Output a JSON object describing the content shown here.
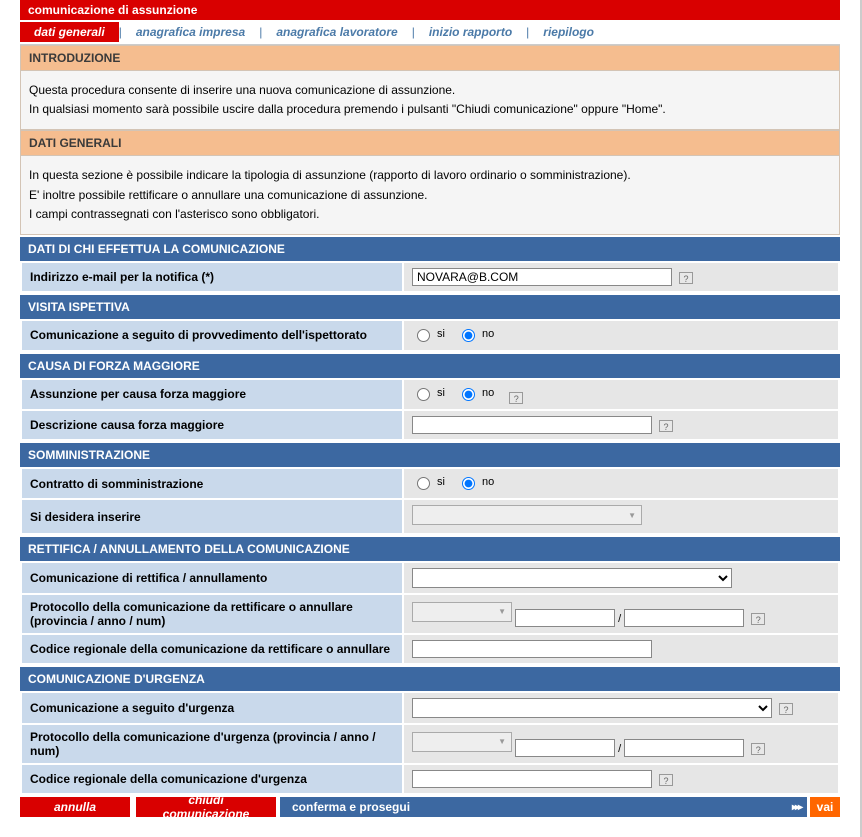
{
  "title_bar": "comunicazione di assunzione",
  "tabs": {
    "t0": "dati generali",
    "t1": "anagrafica impresa",
    "t2": "anagrafica lavoratore",
    "t3": "inizio rapporto",
    "t4": "riepilogo"
  },
  "intro": {
    "header": "INTRODUZIONE",
    "body1": "Questa procedura consente di inserire una nuova comunicazione di assunzione.",
    "body2": "In qualsiasi momento sarà possibile uscire dalla procedura premendo i pulsanti \"Chiudi comunicazione\" oppure \"Home\"."
  },
  "dati_generali": {
    "header": "DATI GENERALI",
    "body1": "In questa sezione è possibile indicare la tipologia di assunzione (rapporto di lavoro ordinario o somministrazione).",
    "body2": "E' inoltre possibile rettificare o annullare una comunicazione di assunzione.",
    "body3": "I campi contrassegnati con l'asterisco sono obbligatori."
  },
  "sections": {
    "s1": {
      "header": "DATI DI CHI EFFETTUA LA COMUNICAZIONE",
      "email_label": "Indirizzo e-mail per la notifica (*)",
      "email_value": "NOVARA@B.COM"
    },
    "s2": {
      "header": "VISITA ISPETTIVA",
      "label": "Comunicazione a seguito di provvedimento dell'ispettorato"
    },
    "s3": {
      "header": "CAUSA DI FORZA MAGGIORE",
      "label1": "Assunzione per causa forza maggiore",
      "label2": "Descrizione causa forza maggiore"
    },
    "s4": {
      "header": "SOMMINISTRAZIONE",
      "label1": "Contratto di somministrazione",
      "label2": "Si desidera inserire"
    },
    "s5": {
      "header": "RETTIFICA / ANNULLAMENTO DELLA COMUNICAZIONE",
      "label1": "Comunicazione di rettifica / annullamento",
      "label2": "Protocollo della comunicazione da rettificare o annullare (provincia / anno / num)",
      "label3": "Codice regionale della comunicazione da rettificare o annullare"
    },
    "s6": {
      "header": "COMUNICAZIONE D'URGENZA",
      "label1": "Comunicazione a seguito d'urgenza",
      "label2": "Protocollo della comunicazione d'urgenza (provincia / anno / num)",
      "label3": "Codice regionale della comunicazione d'urgenza"
    }
  },
  "radio": {
    "si": "si",
    "no": "no"
  },
  "slash": "/",
  "buttons": {
    "annulla": "annulla",
    "chiudi": "chiudi comunicazione",
    "conferma": "conferma e prosegui",
    "arrows": "▸▸▸",
    "vai": "vai"
  },
  "help": "?"
}
